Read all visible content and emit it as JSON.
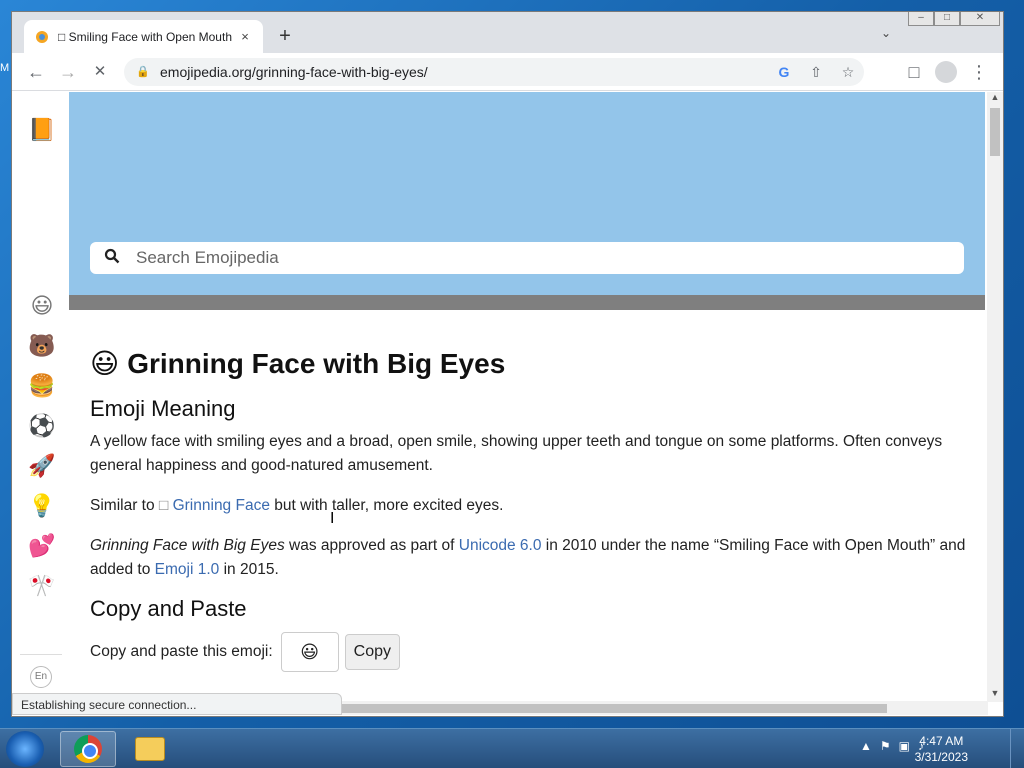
{
  "browser": {
    "tab_title": "□ Smiling Face with Open Mouth",
    "tab_close": "×",
    "new_tab": "+",
    "url": "emojipedia.org/grinning-face-with-big-eyes/",
    "status": "Establishing secure connection..."
  },
  "icons": {
    "back": "←",
    "forward": "→",
    "reload": "✕",
    "lock": "🔒",
    "google": "G",
    "share": "⇧",
    "star": "☆",
    "sidepanel": "□",
    "menu": "⋮",
    "tab_search": "⌄"
  },
  "sidebar": {
    "logo": "📙",
    "items": [
      {
        "icon": "😃",
        "name": "smileys"
      },
      {
        "icon": "🐻",
        "name": "animals"
      },
      {
        "icon": "🍔",
        "name": "food"
      },
      {
        "icon": "⚽",
        "name": "activities"
      },
      {
        "icon": "🚀",
        "name": "travel"
      },
      {
        "icon": "💡",
        "name": "objects"
      },
      {
        "icon": "💕",
        "name": "symbols"
      },
      {
        "icon": "🎌",
        "name": "flags"
      }
    ],
    "lang": "En"
  },
  "search": {
    "placeholder": "Search Emojipedia"
  },
  "article": {
    "emoji": "😃",
    "title": "Grinning Face with Big Eyes",
    "meaning_heading": "Emoji Meaning",
    "meaning_text": "A yellow face with smiling eyes and a broad, open smile, showing upper teeth and tongue on some platforms. Often conveys general happiness and good-natured amusement.",
    "similar_prefix": "Similar to ",
    "similar_glyph": "□",
    "similar_link": "Grinning Face",
    "similar_suffix": " but with taller, more excited eyes.",
    "history_italic": "Grinning Face with Big Eyes",
    "history_1": " was approved as part of ",
    "history_link1": "Unicode 6.0",
    "history_2": " in 2010 under the name “Smiling Face with Open Mouth” and added to ",
    "history_link2": "Emoji 1.0",
    "history_3": " in 2015.",
    "copy_heading": "Copy and Paste",
    "copy_label": "Copy and paste this emoji:",
    "copy_emoji": "😃",
    "copy_button": "Copy"
  },
  "taskbar": {
    "time": "4:47 AM",
    "date": "3/31/2023"
  },
  "window_controls": {
    "minimize": "–",
    "maximize": "□",
    "close": "✕"
  }
}
